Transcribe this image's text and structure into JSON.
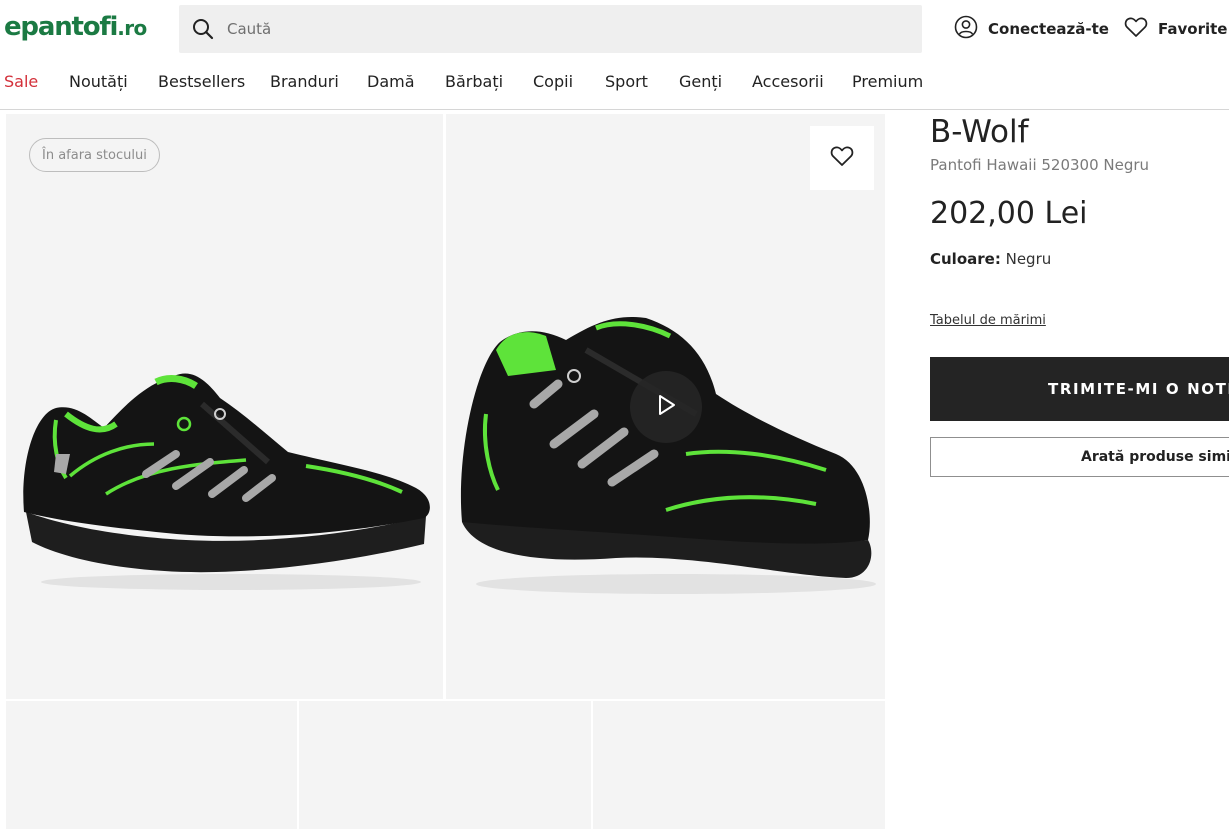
{
  "header": {
    "logo_main": "epantofi",
    "logo_tld": ".ro",
    "search_placeholder": "Caută",
    "login_label": "Conectează-te",
    "favorites_label": "Favorite"
  },
  "nav": {
    "items": [
      "Sale",
      "Noutăți",
      "Bestsellers",
      "Branduri",
      "Damă",
      "Bărbați",
      "Copii",
      "Sport",
      "Genți",
      "Accesorii",
      "Premium"
    ]
  },
  "gallery": {
    "stock_badge": "În afara stocului"
  },
  "product": {
    "brand": "B-Wolf",
    "name": "Pantofi Hawaii 520300 Negru",
    "price": "202,00 Lei",
    "color_label": "Culoare:",
    "color_value": "Negru",
    "size_table_link": "Tabelul de mărimi",
    "notify_button": "TRIMITE-MI O NOTIFICARE",
    "similar_button": "Arată produse similare"
  },
  "colors": {
    "brand_green": "#1b7a43",
    "sale_red": "#d3303a",
    "accent_green": "#5ee33a",
    "button_dark": "#242424"
  },
  "icons": [
    "search-icon",
    "user-icon",
    "heart-icon",
    "play-icon"
  ]
}
